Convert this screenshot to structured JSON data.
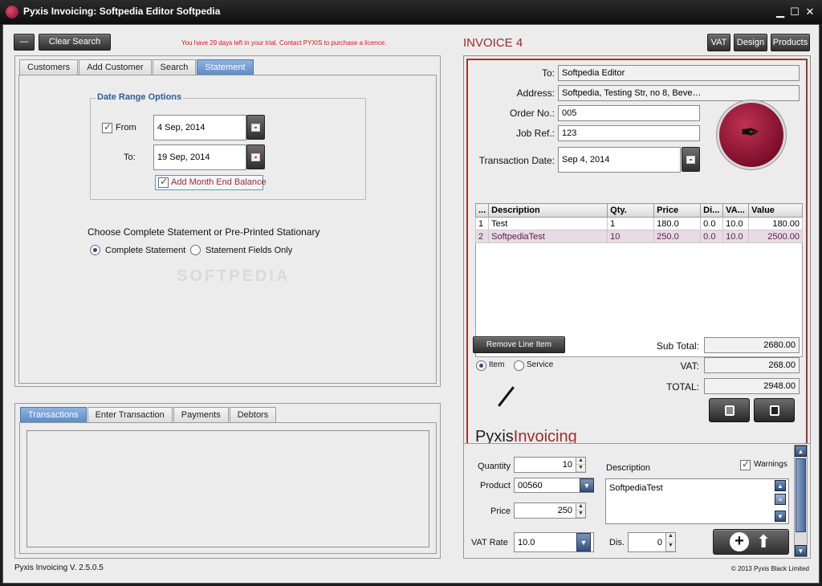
{
  "window": {
    "title": "Pyxis Invoicing: Softpedia Editor Softpedia",
    "minimize": "▁",
    "maximize": "☐",
    "close": "✕"
  },
  "toolbar": {
    "dash_label": "—",
    "clear_search_label": "Clear Search",
    "trial_notice": "You have 29 days left in your trial. Contact PYXIS to purchase a licence."
  },
  "top_tabs": [
    "Customers",
    "Add Customer",
    "Search",
    "Statement"
  ],
  "statement": {
    "group_title": "Date Range Options",
    "from_label": "From",
    "from_value": "4 Sep, 2014",
    "to_label": "To:",
    "to_value": "19 Sep, 2014",
    "month_end_label": "Add Month End Balance",
    "choose_label": "Choose Complete Statement or Pre-Printed Stationary",
    "option_complete": "Complete Statement",
    "option_fields": "Statement Fields Only"
  },
  "bottom_tabs": [
    "Transactions",
    "Enter Transaction",
    "Payments",
    "Debtors"
  ],
  "invoice": {
    "title": "INVOICE 4",
    "vat_button": "VAT",
    "design_button": "Design",
    "products_button": "Products",
    "to_label": "To:",
    "to_value": "Softpedia Editor",
    "address_label": "Address:",
    "address_value": "Softpedia, Testing Str, no 8, Beve…",
    "order_label": "Order No.:",
    "order_value": "005",
    "job_label": "Job Ref.:",
    "job_value": "123",
    "date_label": "Transaction Date:",
    "date_value": "Sep 4, 2014",
    "logo_icon": "fountain-pen-nib-icon"
  },
  "line_items": {
    "headers": [
      "...",
      "Description",
      "Qty.",
      "Price",
      "Di...",
      "VA...",
      "Value"
    ],
    "rows": [
      [
        "1",
        "Test",
        "1",
        "180.0",
        "0.0",
        "10.0",
        "180.00"
      ],
      [
        "2",
        "SoftpediaTest",
        "10",
        "250.0",
        "0.0",
        "10.0",
        "2500.00"
      ]
    ]
  },
  "totals": {
    "remove_label": "Remove Line Item",
    "item_label": "Item",
    "service_label": "Service",
    "subtotal_label": "Sub Total:",
    "subtotal_value": "2680.00",
    "vat_label": "VAT:",
    "vat_value": "268.00",
    "total_label": "TOTAL:",
    "total_value": "2948.00"
  },
  "brand": {
    "part1": "Pyxis",
    "part2": "Invoicing"
  },
  "entry": {
    "quantity_label": "Quantity",
    "quantity_value": "10",
    "product_label": "Product",
    "product_value": "00560",
    "price_label": "Price",
    "price_value": "250",
    "vat_rate_label": "VAT Rate",
    "vat_rate_value": "10.0",
    "description_label": "Description",
    "description_value": "SoftpediaTest",
    "warnings_label": "Warnings",
    "dis_label": "Dis.",
    "dis_value": "0"
  },
  "footer": {
    "version": "Pyxis Invoicing V. 2.5.0.5",
    "copyright": "© 2013 Pyxis Black Limited"
  },
  "watermark": "SOFTPEDIA",
  "colors": {
    "accent_red": "#a32a2a",
    "tab_active_blue": "#5b8ac4",
    "trial_red": "#d41b1b",
    "brand_circle": "#7d0f2c"
  }
}
